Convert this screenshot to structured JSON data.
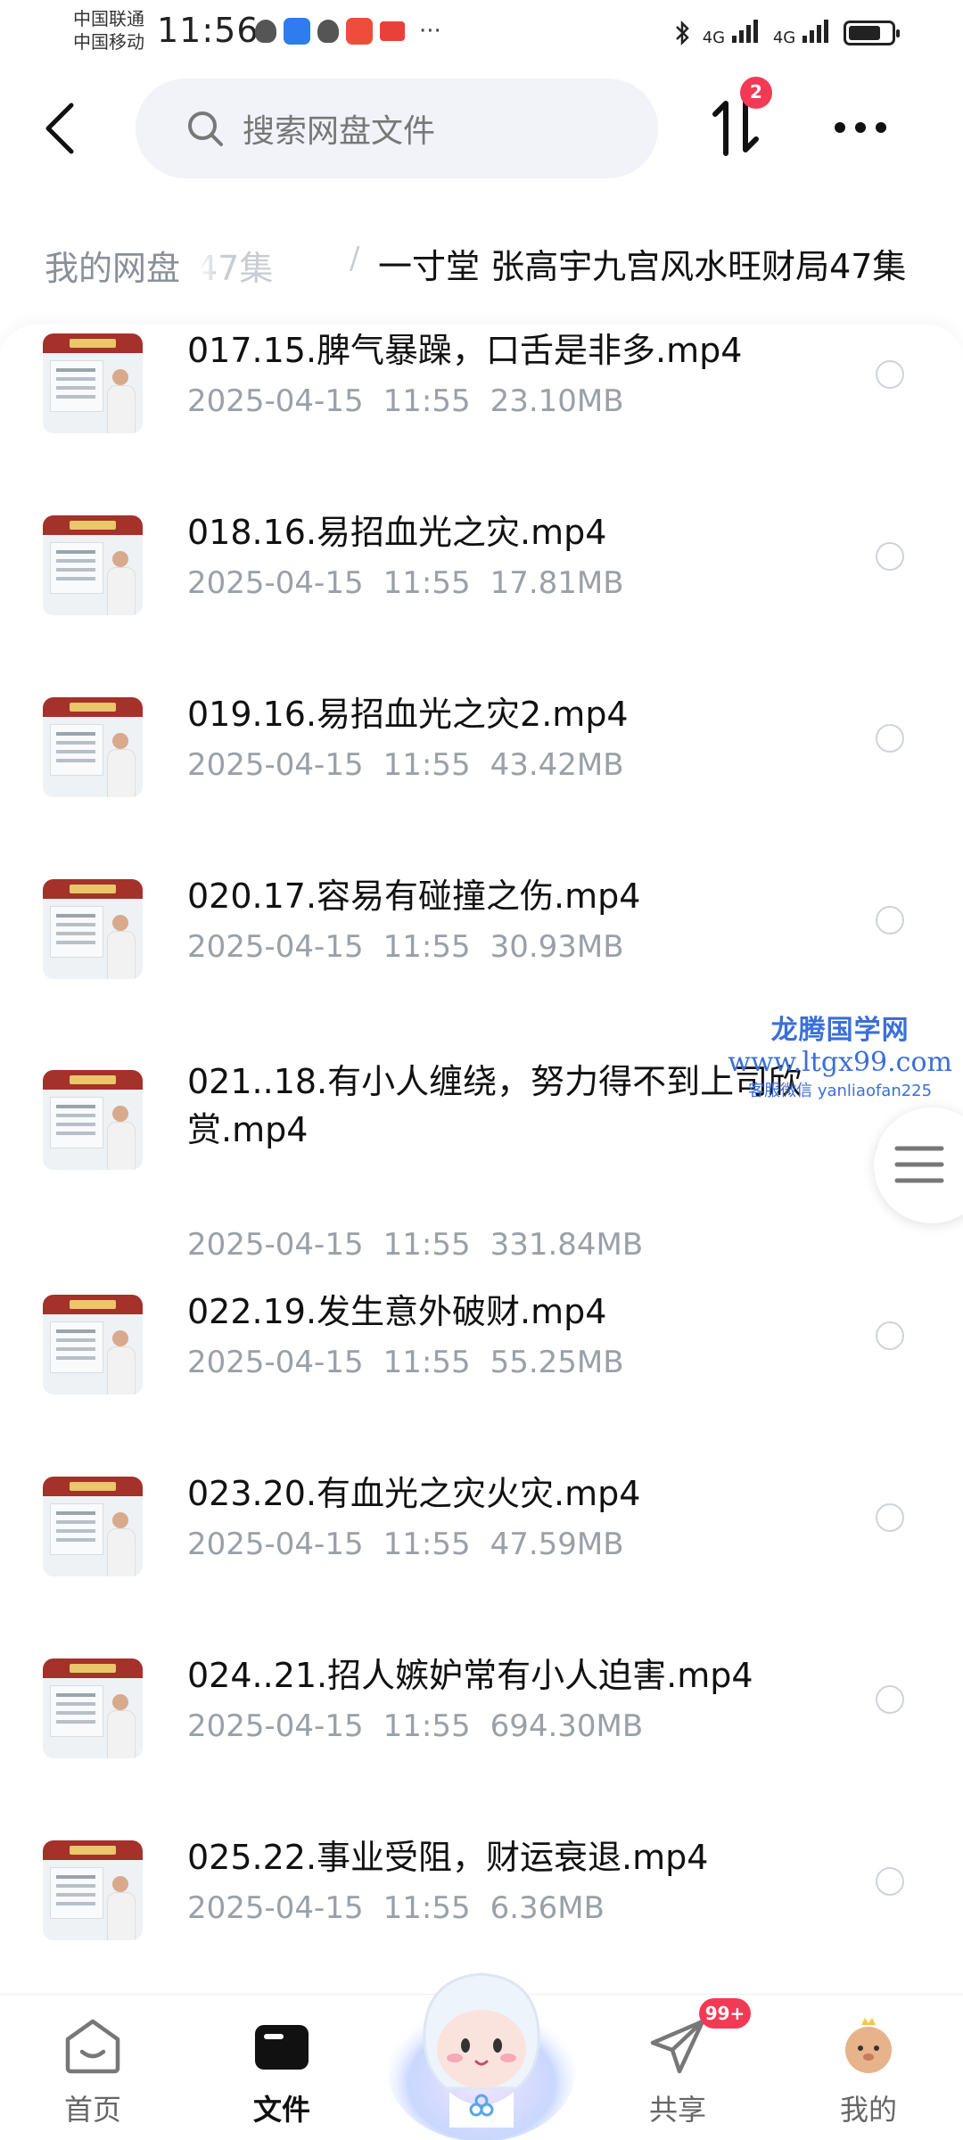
{
  "status_bar": {
    "carrier1": "中国联通",
    "carrier2": "中国移动",
    "time": "11:56",
    "signal1": "4G",
    "signal2": "4G",
    "battery_level": 0.75,
    "more": "···"
  },
  "header": {
    "search_placeholder": "搜索网盘文件",
    "transfer_badge": "2"
  },
  "breadcrumb": {
    "home": "我的网盘",
    "faded": "47集",
    "separator": "/",
    "current": "一寸堂 张高宇九宫风水旺财局47集"
  },
  "files": [
    {
      "name": "017.15.脾气暴躁，口舌是非多.mp4",
      "date": "2025-04-15",
      "time": "11:55",
      "size": "23.10MB"
    },
    {
      "name": "018.16.易招血光之灾.mp4",
      "date": "2025-04-15",
      "time": "11:55",
      "size": "17.81MB"
    },
    {
      "name": "019.16.易招血光之灾2.mp4",
      "date": "2025-04-15",
      "time": "11:55",
      "size": "43.42MB"
    },
    {
      "name": "020.17.容易有碰撞之伤.mp4",
      "date": "2025-04-15",
      "time": "11:55",
      "size": "30.93MB"
    },
    {
      "name": "021..18.有小人缠绕，努力得不到上司欣赏.mp4",
      "date": "2025-04-15",
      "time": "11:55",
      "size": "331.84MB"
    },
    {
      "name": "022.19.发生意外破财.mp4",
      "date": "2025-04-15",
      "time": "11:55",
      "size": "55.25MB"
    },
    {
      "name": "023.20.有血光之灾火灾.mp4",
      "date": "2025-04-15",
      "time": "11:55",
      "size": "47.59MB"
    },
    {
      "name": "024..21.招人嫉妒常有小人迫害.mp4",
      "date": "2025-04-15",
      "time": "11:55",
      "size": "694.30MB"
    },
    {
      "name": "025.22.事业受阻，财运衰退.mp4",
      "date": "2025-04-15",
      "time": "11:55",
      "size": "6.36MB"
    }
  ],
  "watermark": {
    "title": "龙腾国学网",
    "url": "www.ltgx99.com",
    "contact": "客服微信 yanliaofan225"
  },
  "bottom_nav": {
    "home": "首页",
    "files": "文件",
    "share": "共享",
    "share_badge": "99+",
    "mine": "我的"
  },
  "colors": {
    "accent_badge": "#f23a55",
    "text_primary": "#111111",
    "text_secondary": "#9aa0a8",
    "search_bg": "#f1f3f8"
  }
}
